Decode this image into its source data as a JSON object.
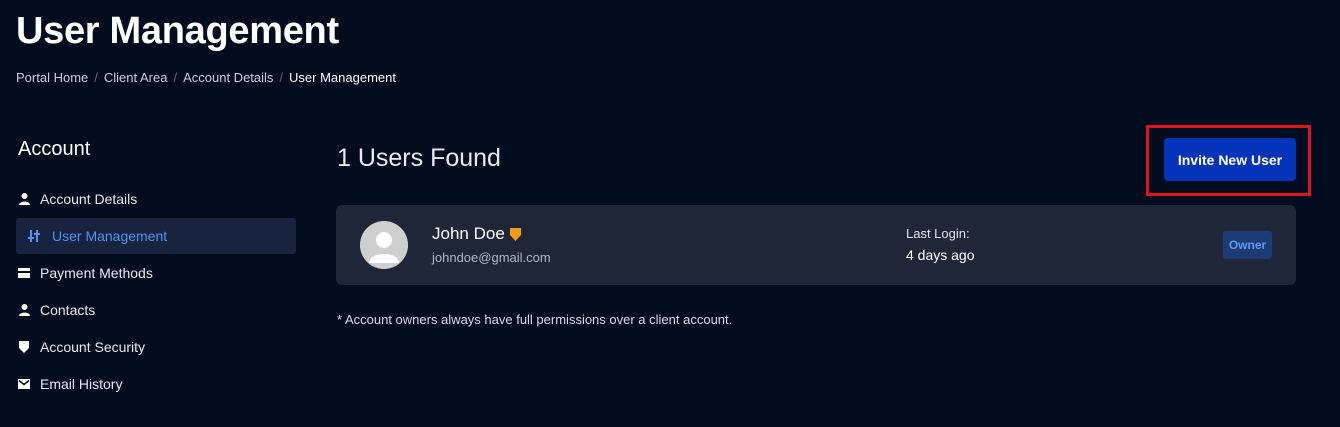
{
  "header": {
    "title": "User Management",
    "breadcrumb": [
      {
        "label": "Portal Home"
      },
      {
        "label": "Client Area"
      },
      {
        "label": "Account Details"
      },
      {
        "label": "User Management"
      }
    ]
  },
  "sidebar": {
    "heading": "Account",
    "items": [
      {
        "label": "Account Details",
        "icon": "user-icon"
      },
      {
        "label": "User Management",
        "icon": "sliders-icon",
        "active": true
      },
      {
        "label": "Payment Methods",
        "icon": "credit-card-icon"
      },
      {
        "label": "Contacts",
        "icon": "user-icon"
      },
      {
        "label": "Account Security",
        "icon": "shield-icon"
      },
      {
        "label": "Email History",
        "icon": "envelope-icon"
      }
    ]
  },
  "main": {
    "users_found": "1 Users Found",
    "invite_label": "Invite New User",
    "users": [
      {
        "name": "John Doe",
        "email": "johndoe@gmail.com",
        "last_login_label": "Last Login:",
        "last_login_value": "4 days ago",
        "role": "Owner"
      }
    ],
    "footnote": "* Account owners always have full permissions over a client account."
  },
  "colors": {
    "background": "#020c1f",
    "card": "#1e2638",
    "accent": "#0533b9",
    "active_link": "#4e93f2",
    "highlight": "#e3131b",
    "owner_shield": "#f39c12"
  }
}
